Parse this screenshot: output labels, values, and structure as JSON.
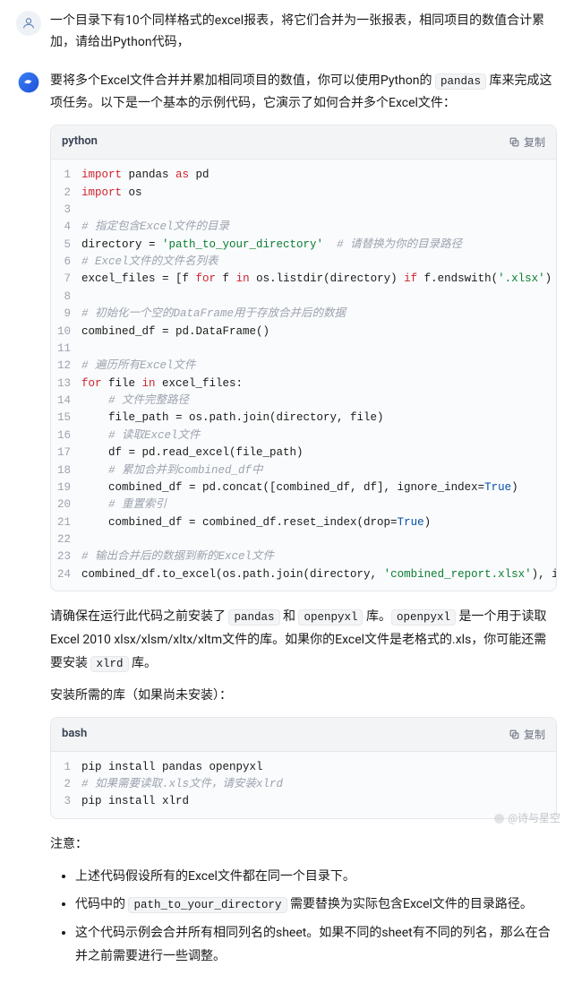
{
  "user_prompt": "一个目录下有10个同样格式的excel报表，将它们合并为一张报表，相同项目的数值合计累加，请给出Python代码，",
  "response": {
    "intro_before": "要将多个Excel文件合并并累加相同项目的数值，你可以使用Python的 ",
    "intro_code": "pandas",
    "intro_after": " 库来完成这项任务。以下是一个基本的示例代码，它演示了如何合并多个Excel文件：",
    "code1_lang": "python",
    "copy_label": "复制",
    "post1_a": "请确保在运行此代码之前安装了 ",
    "post1_b": "pandas",
    "post1_c": " 和 ",
    "post1_d": "openpyxl",
    "post1_e": " 库。",
    "post1_f": "openpyxl",
    "post1_g": " 是一个用于读取 Excel 2010 xlsx/xlsm/xltx/xltm文件的库。如果你的Excel文件是老格式的.xls，你可能还需要安装 ",
    "post1_h": "xlrd",
    "post1_i": " 库。",
    "install_title": "安装所需的库（如果尚未安装）：",
    "code2_lang": "bash",
    "bash_line1": "pip install pandas openpyxl",
    "bash_line2": "# 如果需要读取.xls文件，请安装xlrd",
    "bash_line3": "pip install xlrd",
    "notes_title": "注意：",
    "note1": "上述代码假设所有的Excel文件都在同一个目录下。",
    "note2_a": "代码中的 ",
    "note2_b": "path_to_your_directory",
    "note2_c": " 需要替换为实际包含Excel文件的目录路径。",
    "note3": "这个代码示例会合并所有相同列名的sheet。如果不同的sheet有不同的列名，那么在合并之前需要进行一些调整。"
  },
  "watermark": "@诗与星空"
}
